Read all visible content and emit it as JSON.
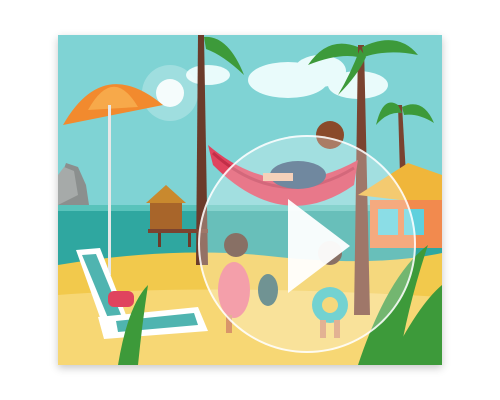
{
  "video": {
    "thumbnail_subject": "beach-vacation-cartoon",
    "state": "paused"
  },
  "play_button": {
    "icon": "play-icon",
    "fill_color": "#ffffff"
  },
  "colors": {
    "sky": "#7fd3d4",
    "sea": "#2fa7a0",
    "sand": "#f2c94c",
    "umbrella": "#f28a2e",
    "hammock": "#e0445e"
  }
}
